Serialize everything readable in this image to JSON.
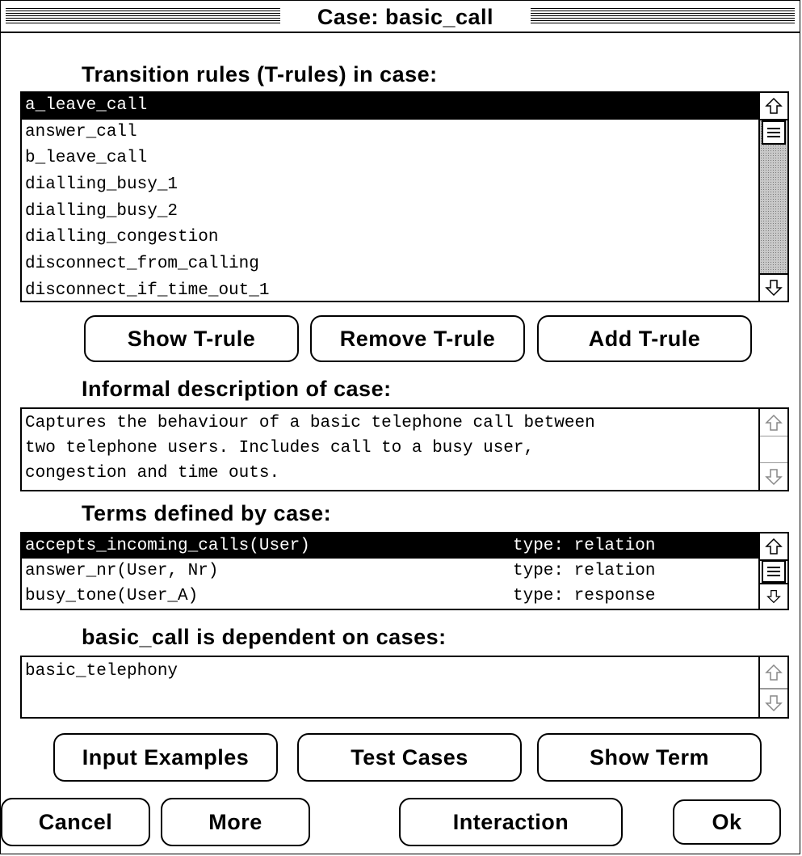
{
  "window": {
    "title": "Case: basic_call"
  },
  "trules": {
    "label": "Transition rules (T-rules) in case:",
    "items": [
      "a_leave_call",
      "answer_call",
      "b_leave_call",
      "dialling_busy_1",
      "dialling_busy_2",
      "dialling_congestion",
      "disconnect_from_calling",
      "disconnect_if_time_out_1"
    ],
    "selected_index": 0,
    "buttons": {
      "show": "Show T-rule",
      "remove": "Remove T-rule",
      "add": "Add T-rule"
    }
  },
  "description": {
    "label": "Informal description of case:",
    "text": "Captures the behaviour of a basic telephone call between\ntwo telephone users. Includes call to a busy user,\ncongestion and time outs."
  },
  "terms": {
    "label": "Terms defined by case:",
    "items": [
      {
        "name": "accepts_incoming_calls(User)",
        "type": "type: relation"
      },
      {
        "name": "answer_nr(User, Nr)",
        "type": "type: relation"
      },
      {
        "name": "busy_tone(User_A)",
        "type": "type: response"
      }
    ],
    "selected_index": 0
  },
  "dependencies": {
    "label": "basic_call is dependent on cases:",
    "text": "basic_telephony"
  },
  "buttons": {
    "input_examples": "Input Examples",
    "test_cases": "Test Cases",
    "show_term": "Show Term",
    "cancel": "Cancel",
    "more": "More",
    "interaction": "Interaction",
    "ok": "Ok"
  },
  "icons": {
    "up": "up-arrow-icon",
    "down": "down-arrow-icon",
    "thumb": "scroll-thumb-grip-icon"
  }
}
